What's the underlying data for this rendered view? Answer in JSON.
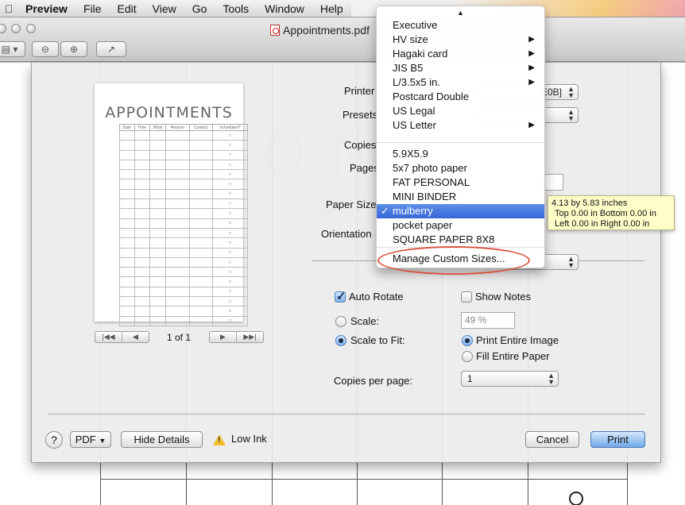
{
  "menubar": {
    "app": "Preview",
    "items": [
      "File",
      "Edit",
      "View",
      "Go",
      "Tools",
      "Window",
      "Help"
    ]
  },
  "window": {
    "title": "Appointments.pdf"
  },
  "preview": {
    "title": "APPOINTMENTS",
    "columns": [
      "Date",
      "Time",
      "What",
      "Reason",
      "Contact",
      "Scheduled?"
    ],
    "row_count": 20,
    "page_label": "1 of 1"
  },
  "form": {
    "printer_label": "Printer",
    "printer_value": "E0B]",
    "presets_label": "Presets",
    "copies_label": "Copies",
    "pages_label": "Pages",
    "paper_size_label": "Paper Size",
    "orientation_label": "Orientation",
    "auto_rotate_label": "Auto Rotate",
    "show_notes_label": "Show Notes",
    "scale_label": "Scale:",
    "scale_value": "49 %",
    "scale_to_fit_label": "Scale to Fit:",
    "print_entire_image_label": "Print Entire Image",
    "fill_entire_paper_label": "Fill Entire Paper",
    "copies_per_page_label": "Copies per page:",
    "copies_per_page_value": "1"
  },
  "buttons": {
    "help": "?",
    "pdf": "PDF",
    "hide_details": "Hide Details",
    "low_ink": "Low Ink",
    "cancel": "Cancel",
    "print": "Print"
  },
  "paper_menu": {
    "group1": [
      {
        "label": "Executive",
        "submenu": false
      },
      {
        "label": "HV size",
        "submenu": true
      },
      {
        "label": "Hagaki card",
        "submenu": true
      },
      {
        "label": "JIS B5",
        "submenu": true
      },
      {
        "label": "L/3.5x5 in.",
        "submenu": true
      },
      {
        "label": "Postcard Double",
        "submenu": false
      },
      {
        "label": "US Legal",
        "submenu": false
      },
      {
        "label": "US Letter",
        "submenu": true
      }
    ],
    "group2": [
      {
        "label": "5.9X5.9",
        "selected": false
      },
      {
        "label": "5x7 photo paper",
        "selected": false
      },
      {
        "label": "FAT PERSONAL",
        "selected": false
      },
      {
        "label": "MINI BINDER",
        "selected": false
      },
      {
        "label": "mulberry",
        "selected": true
      },
      {
        "label": "pocket paper",
        "selected": false
      },
      {
        "label": "SQUARE PAPER 8X8",
        "selected": false
      }
    ],
    "manage": "Manage Custom Sizes..."
  },
  "tooltip": {
    "line1": "4.13 by 5.83 inches",
    "line2": "Top 0.00 in Bottom 0.00 in",
    "line3": "Left 0.00 in Right 0.00 in"
  }
}
